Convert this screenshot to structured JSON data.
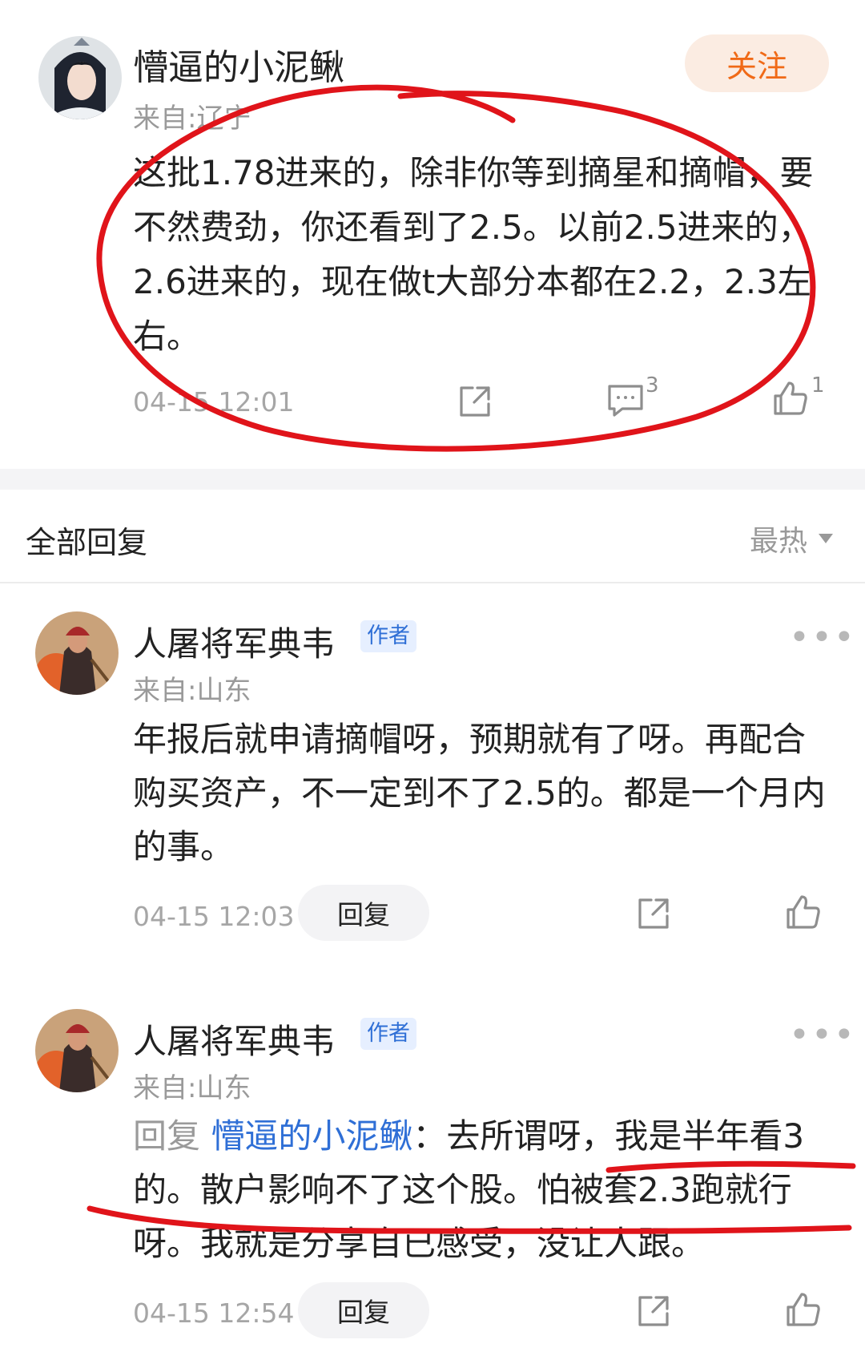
{
  "post": {
    "author": "懵逼的小泥鳅",
    "location": "来自:辽宁",
    "follow_label": "关注",
    "content": "这批1.78进来的，除非你等到摘星和摘帽，要不然费劲，你还看到了2.5。以前2.5进来的，2.6进来的，现在做t大部分本都在2.2，2.3左右。",
    "time": "04-15 12:01",
    "comment_count": "3",
    "like_count": "1"
  },
  "replies_header": {
    "title": "全部回复",
    "sort_label": "最热"
  },
  "replies": [
    {
      "author": "人屠将军典韦",
      "badge": "作者",
      "location": "来自:山东",
      "content": "年报后就申请摘帽呀，预期就有了呀。再配合购买资产，不一定到不了2.5的。都是一个月内的事。",
      "time": "04-15 12:03",
      "reply_label": "回复",
      "more_label": "•••"
    },
    {
      "author": "人屠将军典韦",
      "badge": "作者",
      "location": "来自:山东",
      "reply_prefix": "回复 ",
      "mention": "懵逼的小泥鳅",
      "content": "：去所谓呀，我是半年看3的。散户影响不了这个股。怕被套2.3跑就行呀。我就是分享自已感受，没让人跟。",
      "time": "04-15 12:54",
      "reply_label": "回复",
      "more_label": "•••"
    }
  ],
  "colors": {
    "accent_orange": "#f06a17",
    "link_blue": "#2f6fd6",
    "annotation_red": "#e0141a"
  }
}
